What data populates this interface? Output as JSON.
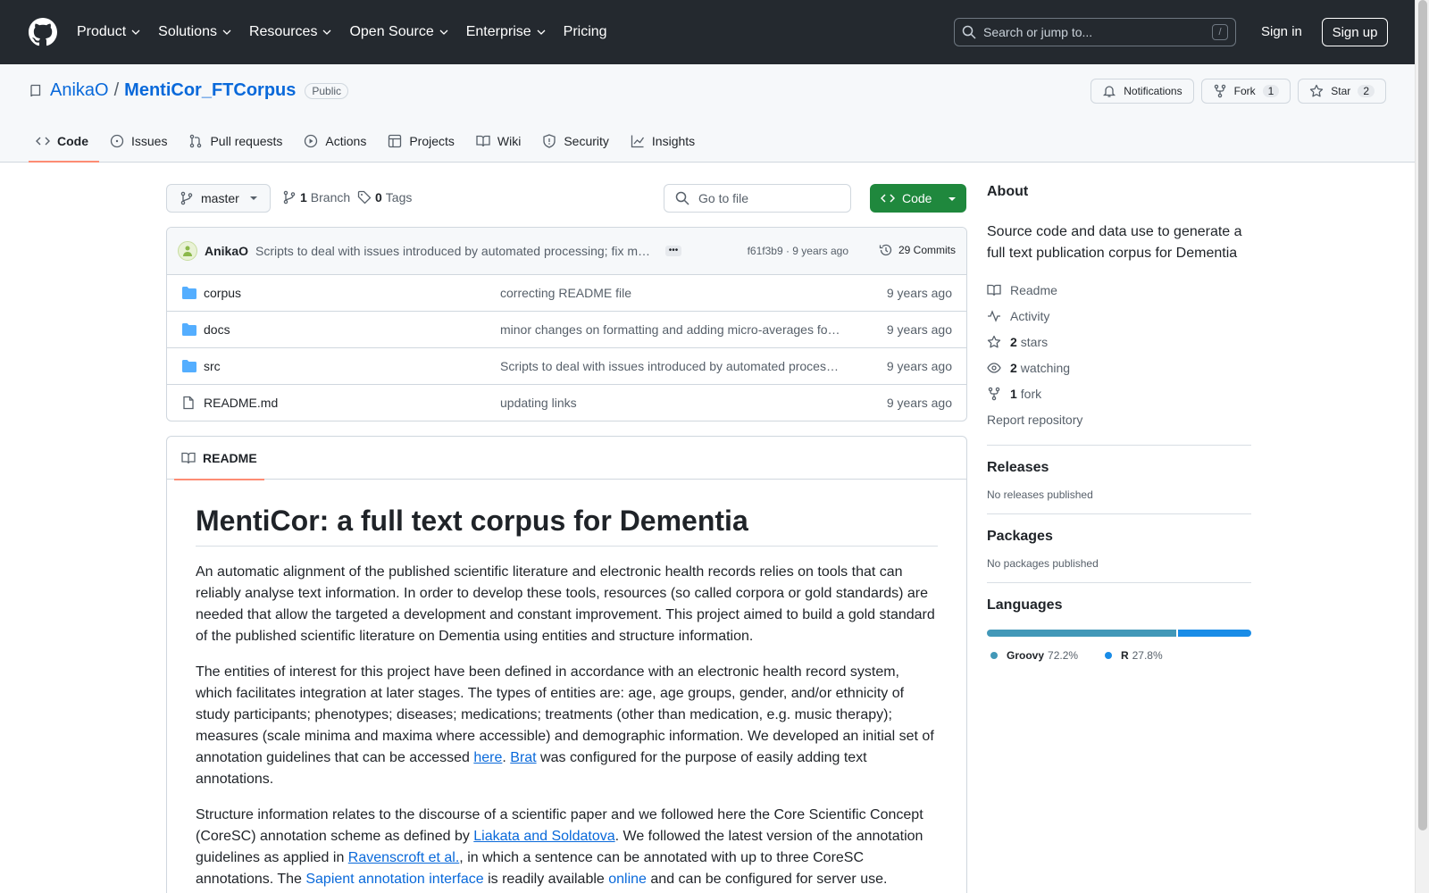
{
  "header": {
    "nav": [
      "Product",
      "Solutions",
      "Resources",
      "Open Source",
      "Enterprise",
      "Pricing"
    ],
    "search_placeholder": "Search or jump to...",
    "search_key": "/",
    "signin": "Sign in",
    "signup": "Sign up"
  },
  "repo": {
    "owner": "AnikaO",
    "separator": "/",
    "name": "MentiCor_FTCorpus",
    "visibility": "Public",
    "notifications_label": "Notifications",
    "fork_label": "Fork",
    "fork_count": "1",
    "star_label": "Star",
    "star_count": "2",
    "tabs": [
      "Code",
      "Issues",
      "Pull requests",
      "Actions",
      "Projects",
      "Wiki",
      "Security",
      "Insights"
    ]
  },
  "branchbar": {
    "branch": "master",
    "branches_count": "1",
    "branches_label": "Branch",
    "tags_count": "0",
    "tags_label": "Tags",
    "goto_placeholder": "Go to file",
    "code_button": "Code"
  },
  "commit": {
    "author": "AnikaO",
    "message": "Scripts to deal with issues introduced by automated processing; fix m…",
    "hash_time": "f61f3b9 · 9 years ago",
    "commits_label": "29 Commits"
  },
  "files": [
    {
      "name": "corpus",
      "type": "folder",
      "message": "correcting README file",
      "date": "9 years ago"
    },
    {
      "name": "docs",
      "type": "folder",
      "message": "minor changes on formatting and adding micro-averages fo…",
      "date": "9 years ago"
    },
    {
      "name": "src",
      "type": "folder",
      "message": "Scripts to deal with issues introduced by automated proces…",
      "date": "9 years ago"
    },
    {
      "name": "README.md",
      "type": "file",
      "message": "updating links",
      "date": "9 years ago"
    }
  ],
  "readme": {
    "tab_label": "README",
    "title": "MentiCor: a full text corpus for Dementia",
    "p1": "An automatic alignment of the published scientific literature and electronic health records relies on tools that can reliably analyse text information. In order to develop these tools, resources (so called corpora or gold standards) are needed that allow the targeted a development and constant improvement. This project aimed to build a gold standard of the published scientific literature on Dementia using entities and structure information.",
    "p2_a": "The entities of interest for this project have been defined in accordance with an electronic health record system, which facilitates integration at later stages. The types of entities are: age, age groups, gender, and/or ethnicity of study participants; phenotypes; diseases; medications; treatments (other than medication, e.g. music therapy); measures (scale minima and maxima where accessible) and demographic information. We developed an initial set of annotation guidelines that can be accessed ",
    "p2_link1": "here",
    "p2_b": ". ",
    "p2_link2": "Brat",
    "p2_c": " was configured for the purpose of easily adding text annotations.",
    "p3_a": "Structure information relates to the discourse of a scientific paper and we followed here the Core Scientific Concept (CoreSC) annotation scheme as defined by ",
    "p3_link1": "Liakata and Soldatova",
    "p3_b": ". We followed the latest version of the annotation guidelines as applied in ",
    "p3_link2": "Ravenscroft et al.",
    "p3_c": ", in which a sentence can be annotated with up to three CoreSC annotations. The ",
    "p3_link3": "Sapient annotation interface",
    "p3_d": " is readily available ",
    "p3_link4": "online",
    "p3_e": " and can be configured for server use."
  },
  "sidebar": {
    "about_heading": "About",
    "about_text": "Source code and data use to generate a full text publication corpus for Dementia",
    "readme": "Readme",
    "activity": "Activity",
    "stars_count": "2",
    "stars_label": "stars",
    "watching_count": "2",
    "watching_label": "watching",
    "forks_count": "1",
    "forks_label": "fork",
    "report": "Report repository",
    "releases_heading": "Releases",
    "releases_text": "No releases published",
    "packages_heading": "Packages",
    "packages_text": "No packages published",
    "languages_heading": "Languages",
    "languages": [
      {
        "name": "Groovy",
        "percent": "72.2%",
        "value": 72.2,
        "color": "#4298b8"
      },
      {
        "name": "R",
        "percent": "27.8%",
        "value": 27.8,
        "color": "#198ce7"
      }
    ]
  }
}
